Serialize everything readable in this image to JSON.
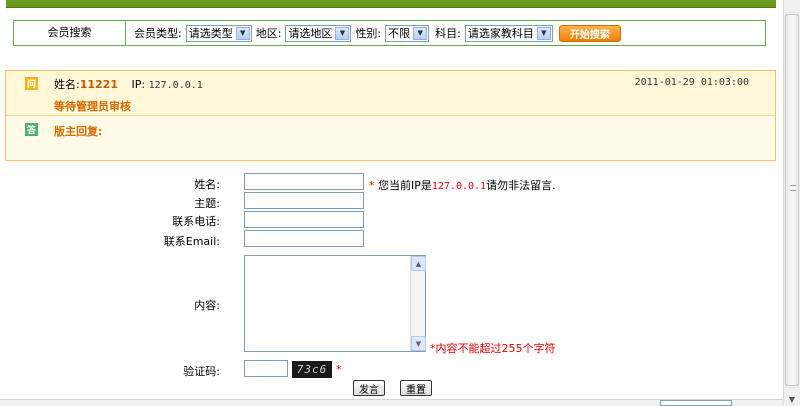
{
  "search": {
    "title": "会员搜索",
    "type_label": "会员类型:",
    "type_value": "请选类型",
    "area_label": "地区:",
    "area_value": "请选地区",
    "gender_label": "性别:",
    "gender_value": "不限",
    "subject_label": "科目:",
    "subject_value": "请选家教科目",
    "button": "开始搜索"
  },
  "message": {
    "q_badge": "问",
    "name_label": "姓名:",
    "name_value": "11221",
    "ip_label": "IP:",
    "ip_value": "127.0.0.1",
    "datetime": "2011-01-29 01:03:00",
    "status": "等待管理员审核",
    "a_badge": "答",
    "reply_label": "版主回复:"
  },
  "form": {
    "name_label": "姓名:",
    "subject_label": "主题:",
    "phone_label": "联系电话:",
    "email_label": "联系Email:",
    "content_label": "内容:",
    "captcha_label": "验证码:",
    "star": "*",
    "ip_note_pre": "您当前IP是",
    "ip_note_ip": "127.0.0.1",
    "ip_note_post": "请勿非法留言.",
    "content_note": "*内容不能超过255个字符",
    "captcha_text": "73c6",
    "submit": "发言",
    "reset": "重置"
  },
  "icons": {
    "dropdown": "chevron-down-icon",
    "scroll_up": "triangle-up-icon",
    "scroll_down": "triangle-down-icon"
  },
  "colors": {
    "green_bar": "#6a9a1e",
    "orange_text": "#d46a00",
    "red_text": "#e60000",
    "button_orange": "#f07c0b"
  }
}
